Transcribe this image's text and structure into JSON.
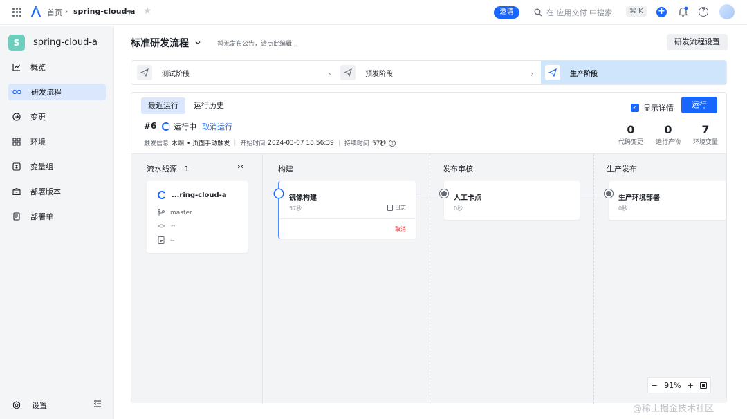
{
  "topbar": {
    "home": "首页",
    "project": "spring-cloud-a",
    "invite": "邀请",
    "search_placeholder": "在 应用交付 中搜索",
    "shortcut": "⌘ K",
    "plus": "+",
    "help": "?"
  },
  "sidebar": {
    "badge": "S",
    "project_name": "spring-cloud-a",
    "items": [
      {
        "label": "概览",
        "icon": "chart-icon"
      },
      {
        "label": "研发流程",
        "icon": "infinity-icon"
      },
      {
        "label": "变更",
        "icon": "change-icon"
      },
      {
        "label": "环境",
        "icon": "grid-icon"
      },
      {
        "label": "变量组",
        "icon": "variable-icon"
      },
      {
        "label": "部署版本",
        "icon": "box-icon"
      },
      {
        "label": "部署单",
        "icon": "document-icon"
      }
    ],
    "settings": "设置"
  },
  "header": {
    "title": "标准研发流程",
    "notice": "暂无发布公告，请点此编辑...",
    "flow_settings": "研发流程设置"
  },
  "stages": [
    {
      "label": "测试阶段"
    },
    {
      "label": "预发阶段"
    },
    {
      "label": "生产阶段"
    }
  ],
  "run": {
    "tabs": [
      "最近运行",
      "运行历史"
    ],
    "show_detail": "显示详情",
    "run_button": "运行",
    "number": "#6",
    "state": "运行中",
    "cancel": "取消运行",
    "trigger_label": "触发信息",
    "trigger_user": "木烟",
    "trigger_type": "• 页面手动触发",
    "start_label": "开始时间",
    "start_time": "2024-03-07 18:56:39",
    "duration_label": "持续时间",
    "duration": "57秒",
    "stats": [
      {
        "value": "0",
        "label": "代码变更"
      },
      {
        "value": "0",
        "label": "运行产物"
      },
      {
        "value": "7",
        "label": "环境变量"
      }
    ]
  },
  "pipeline": {
    "source_title": "流水线源 · 1",
    "collapse": "›‹",
    "source": {
      "name": "...ring-cloud-a",
      "branch": "master",
      "commit": "--",
      "message": "--"
    },
    "columns": [
      "构建",
      "发布审核",
      "生产发布"
    ],
    "jobs": [
      {
        "name": "镜像构建",
        "time": "57秒",
        "log": "日志",
        "cancel": "取消"
      },
      {
        "name": "人工卡点",
        "time": "0秒"
      },
      {
        "name": "生产环境部署",
        "time": "0秒"
      }
    ],
    "zoom": {
      "minus": "−",
      "value": "91%",
      "plus": "+"
    }
  },
  "watermark": "@稀土掘金技术社区",
  "colors": {
    "accent": "#1966ff",
    "active_bg": "#dbe7fd",
    "stage_active_bg": "#cfe5fb",
    "danger": "#e0262b"
  }
}
